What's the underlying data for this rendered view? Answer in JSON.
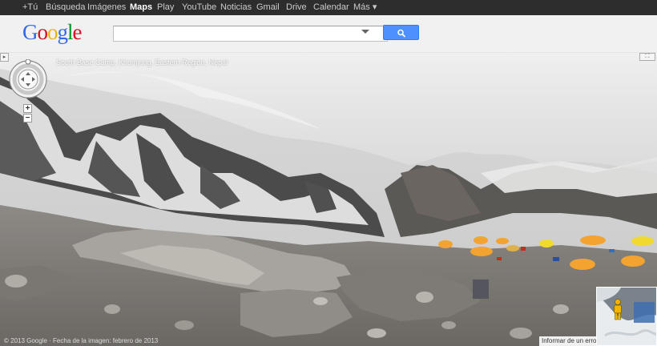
{
  "topbar": {
    "items": [
      "+Tú",
      "Búsqueda",
      "Imágenes",
      "Maps",
      "Play",
      "YouTube",
      "Noticias",
      "Gmail",
      "Drive",
      "Calendar",
      "Más ▾"
    ],
    "active": "Maps"
  },
  "header": {
    "logo_text": "Google",
    "logo_colors": [
      "#3369e8",
      "#d50f25",
      "#eeb211",
      "#3369e8",
      "#009925",
      "#d50f25"
    ],
    "search_value": "",
    "search_button_color": "#4d90fe"
  },
  "streetview": {
    "location": "South Base Camp, Khumjung, Eastern Region, Nepal",
    "copyright": "© 2013 Google · Fecha de la imagen: febrero de 2013",
    "report_label": "Informar de un error",
    "zoom_in_label": "+",
    "zoom_out_label": "−",
    "side_toggle_label": "▸",
    "expand_label": "⛶"
  }
}
